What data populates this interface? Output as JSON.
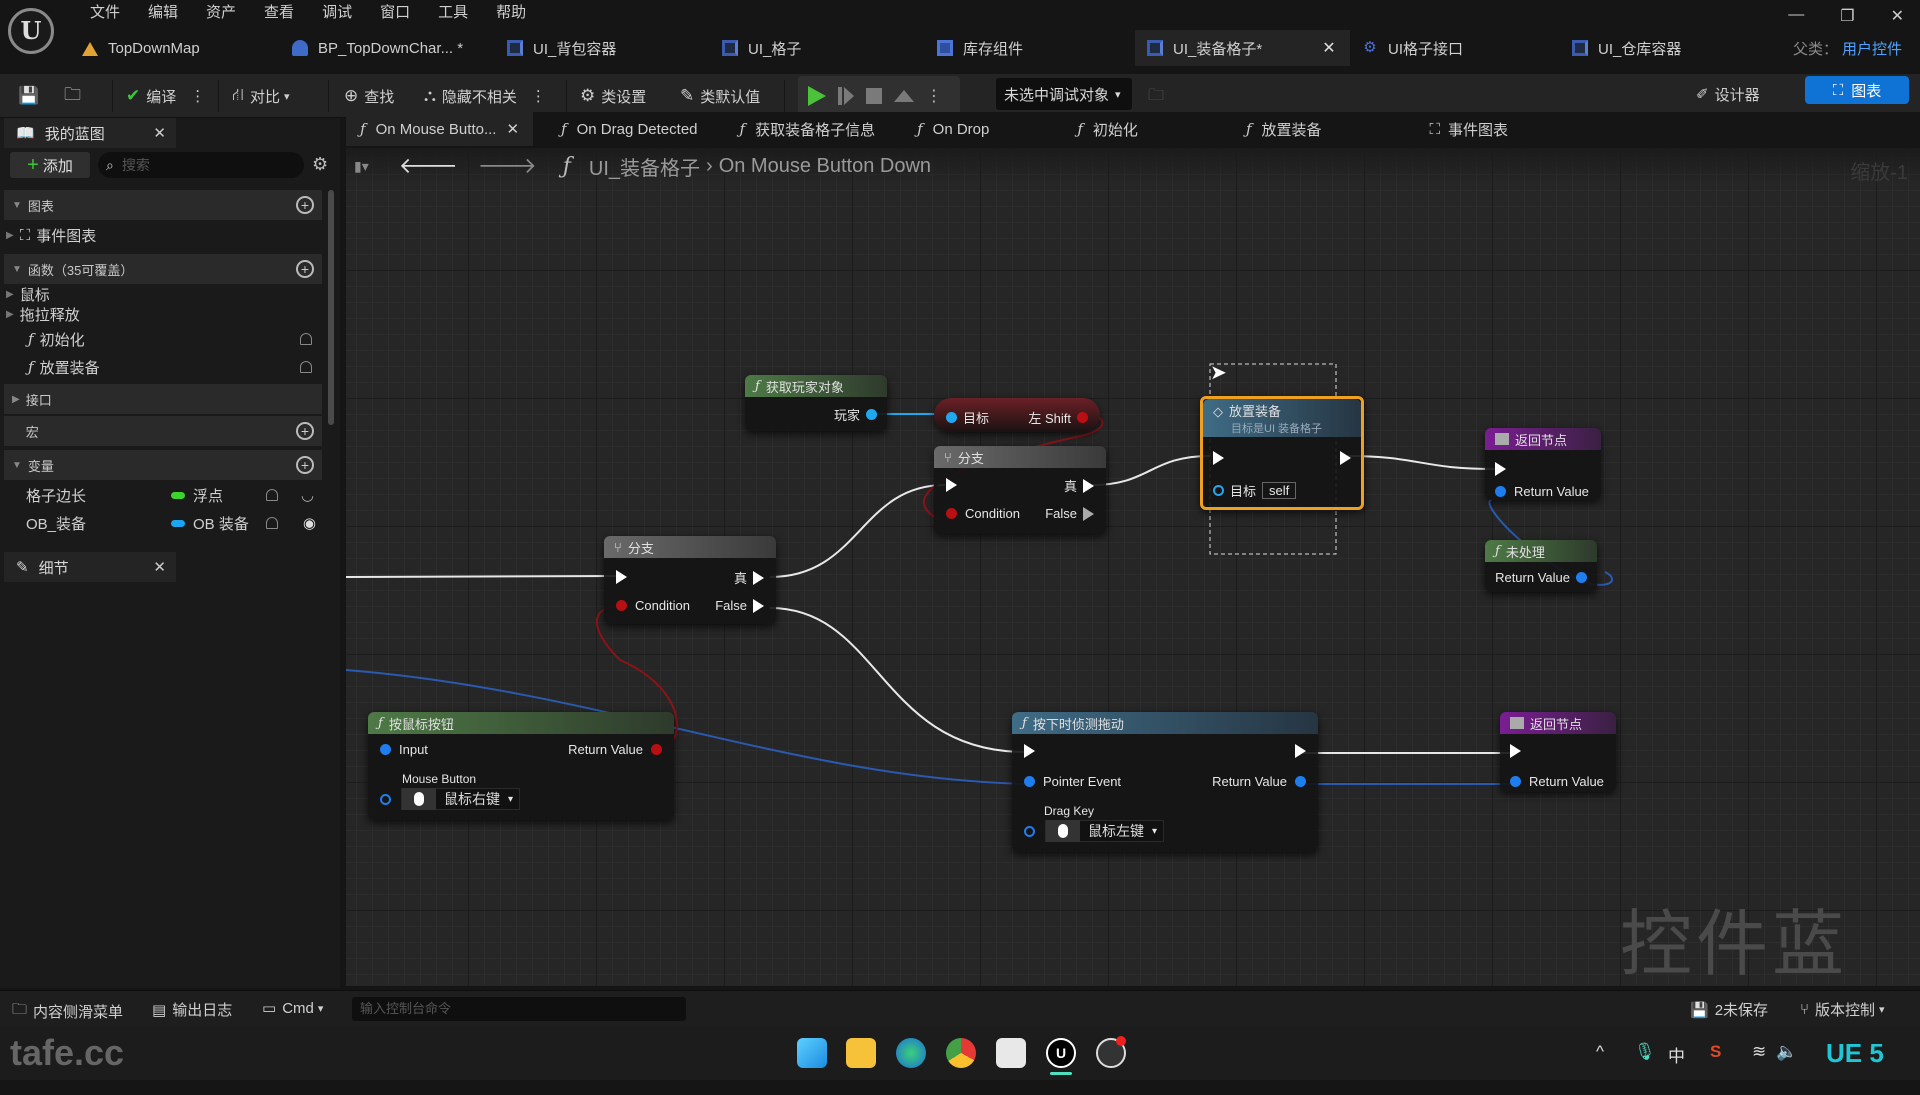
{
  "app": {
    "menu": [
      "文件",
      "编辑",
      "资产",
      "查看",
      "调试",
      "窗口",
      "工具",
      "帮助"
    ],
    "doc_tabs": [
      {
        "label": "TopDownMap",
        "icon": "map-icon"
      },
      {
        "label": "BP_TopDownChar... *",
        "icon": "character-blueprint-icon"
      },
      {
        "label": "UI_背包容器",
        "icon": "widget-blueprint-icon"
      },
      {
        "label": "UI_格子",
        "icon": "widget-blueprint-icon"
      },
      {
        "label": "库存组件",
        "icon": "component-icon"
      },
      {
        "label": "UI_装备格子*",
        "icon": "widget-blueprint-icon",
        "active": true
      },
      {
        "label": "UI格子接口",
        "icon": "interface-icon"
      },
      {
        "label": "UI_仓库容器",
        "icon": "widget-blueprint-icon"
      }
    ],
    "parent_class_label": "父类：",
    "parent_class_value": "用户控件",
    "window_controls": [
      "minimize",
      "restore",
      "close"
    ]
  },
  "toolbar": {
    "compile": "编译",
    "diff": "对比",
    "find": "查找",
    "hide_unrelated": "隐藏不相关",
    "class_settings": "类设置",
    "class_defaults": "类默认值",
    "debug_object": "未选中调试对象",
    "designer": "设计器",
    "graph": "图表"
  },
  "my_blueprint": {
    "title": "我的蓝图",
    "add": "添加",
    "search_placeholder": "搜索",
    "sections": {
      "graphs": "图表",
      "event_graph": "事件图表",
      "functions": "函数（35可覆盖）",
      "mouse": "鼠标",
      "drag_drop": "拖拉释放",
      "func_init": "初始化",
      "func_place": "放置装备",
      "interfaces": "接口",
      "macros": "宏",
      "variables": "变量"
    },
    "variables": [
      {
        "name": "格子边长",
        "type": "浮点",
        "color": "#3cd42a"
      },
      {
        "name": "OB_装备",
        "type": "OB 装备",
        "color": "#1aa6f0"
      }
    ]
  },
  "details": {
    "title": "细节"
  },
  "function_tabs": [
    {
      "label": "On Mouse Butto...",
      "active": true
    },
    {
      "label": "On Drag Detected"
    },
    {
      "label": "获取装备格子信息"
    },
    {
      "label": "On Drop"
    },
    {
      "label": "初始化"
    },
    {
      "label": "放置装备"
    },
    {
      "label": "事件图表",
      "icon": "event-graph-icon"
    }
  ],
  "breadcrumb": {
    "root": "UI_装备格子",
    "sep": "›",
    "current": "On Mouse Button Down"
  },
  "zoom_label": "缩放-1",
  "watermark": "控件蓝图",
  "nodes": {
    "get_player": {
      "title": "获取玩家对象",
      "out": "玩家"
    },
    "left_shift": {
      "in": "目标",
      "out": "左 Shift"
    },
    "branch1": {
      "title": "分支",
      "true": "真",
      "condition": "Condition",
      "false": "False"
    },
    "branch2": {
      "title": "分支",
      "true": "真",
      "condition": "Condition",
      "false": "False"
    },
    "place_equip": {
      "title": "放置装备",
      "subtitle": "目标是UI 装备格子",
      "target": "目标",
      "target_value": "self"
    },
    "return1": {
      "title": "返回节点",
      "out": "Return Value"
    },
    "unhandled": {
      "title": "未处理",
      "out": "Return Value"
    },
    "mouse_btn": {
      "title": "按鼠标按钮",
      "input": "Input",
      "return": "Return Value",
      "mouse_button": "Mouse Button",
      "key": "鼠标右键"
    },
    "detect_drag": {
      "title": "按下时侦测拖动",
      "pointer": "Pointer Event",
      "return": "Return Value",
      "drag_key": "Drag Key",
      "key": "鼠标左键"
    },
    "return2": {
      "title": "返回节点",
      "out": "Return Value"
    }
  },
  "bottom": {
    "content_drawer": "内容侧滑菜单",
    "output_log": "输出日志",
    "cmd": "Cmd",
    "cmd_placeholder": "输入控制台命令",
    "unsaved": "2未保存",
    "source_control": "版本控制"
  },
  "taskbar": {
    "watermark": "tafe.cc",
    "apps": [
      "windows-start",
      "file-explorer",
      "edge",
      "chrome",
      "microsoft-store",
      "unreal-engine",
      "obs"
    ],
    "ime": "中",
    "ue5_badge": "UE 5"
  }
}
